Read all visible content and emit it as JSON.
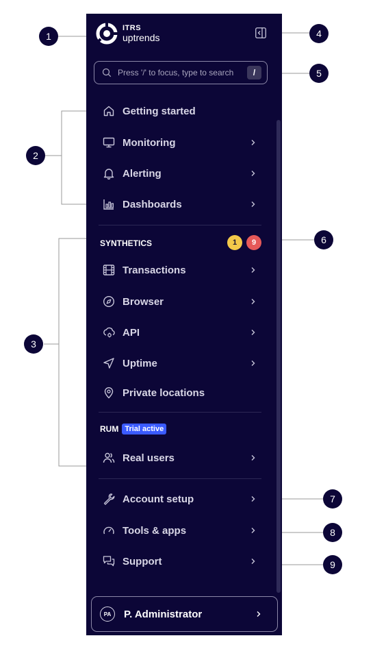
{
  "logo": {
    "line1": "ITRS",
    "line2": "uptrends"
  },
  "search": {
    "placeholder": "Press '/' to focus, type to search",
    "shortcut": "/"
  },
  "nav_main": [
    {
      "label": "Getting started",
      "icon": "home-icon",
      "chevron": false
    },
    {
      "label": "Monitoring",
      "icon": "monitor-icon",
      "chevron": true
    },
    {
      "label": "Alerting",
      "icon": "bell-icon",
      "chevron": true
    },
    {
      "label": "Dashboards",
      "icon": "chart-icon",
      "chevron": true
    }
  ],
  "synthetics": {
    "heading": "SYNTHETICS",
    "badges": [
      "1",
      "9"
    ],
    "badge_colors": [
      "#f3c94a",
      "#e55959"
    ],
    "items": [
      {
        "label": "Transactions",
        "icon": "film-icon",
        "chevron": true
      },
      {
        "label": "Browser",
        "icon": "compass-icon",
        "chevron": true
      },
      {
        "label": "API",
        "icon": "cloud-settings-icon",
        "chevron": true
      },
      {
        "label": "Uptime",
        "icon": "send-icon",
        "chevron": true
      },
      {
        "label": "Private locations",
        "icon": "map-pin-icon",
        "chevron": false
      }
    ]
  },
  "rum": {
    "heading": "RUM",
    "trial": "Trial active",
    "trial_color": "#3b5bff",
    "items": [
      {
        "label": "Real users",
        "icon": "users-icon",
        "chevron": true
      }
    ]
  },
  "nav_bottom": [
    {
      "label": "Account setup",
      "icon": "wrench-icon",
      "chevron": true
    },
    {
      "label": "Tools & apps",
      "icon": "gauge-icon",
      "chevron": true
    },
    {
      "label": "Support",
      "icon": "chat-icon",
      "chevron": true
    }
  ],
  "user": {
    "initials": "PA",
    "name": "P. Administrator"
  },
  "callouts": [
    "1",
    "2",
    "3",
    "4",
    "5",
    "6",
    "7",
    "8",
    "9"
  ],
  "colors": {
    "sidebar_bg": "#0c0637",
    "text": "#d8d6e6"
  }
}
